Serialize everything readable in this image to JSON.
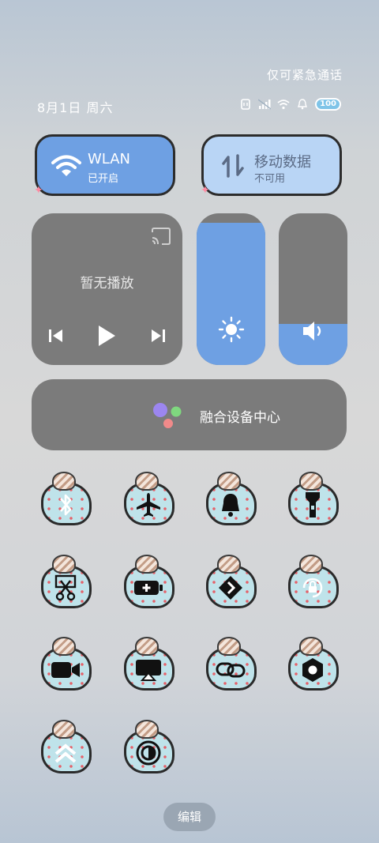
{
  "status_bar": {
    "emergency_text": "仅可紧急通话",
    "date": "8月1日 周六",
    "battery": "100"
  },
  "tiles": {
    "wlan": {
      "title": "WLAN",
      "subtitle": "已开启",
      "icon": "wifi-icon",
      "active": true
    },
    "mobile": {
      "title": "移动数据",
      "subtitle": "不可用",
      "icon": "mobile-data-icon",
      "active": false
    }
  },
  "media": {
    "no_play_text": "暂无播放"
  },
  "sliders": {
    "brightness": {
      "level": 0.94,
      "icon": "sun-icon"
    },
    "volume": {
      "level": 0.27,
      "icon": "speaker-icon"
    }
  },
  "fusion": {
    "label": "融合设备中心"
  },
  "quick_toggles": [
    {
      "name": "bluetooth",
      "icon": "bluetooth-icon",
      "active": false
    },
    {
      "name": "airplane-mode",
      "icon": "airplane-icon",
      "active": false
    },
    {
      "name": "sound",
      "icon": "bell-icon",
      "active": false
    },
    {
      "name": "flashlight",
      "icon": "flashlight-icon",
      "active": false
    },
    {
      "name": "screenshot",
      "icon": "scissors-icon",
      "active": false
    },
    {
      "name": "battery-saver",
      "icon": "battery-plus-icon",
      "active": false
    },
    {
      "name": "share",
      "icon": "share-arrow-icon",
      "active": false
    },
    {
      "name": "auto-rotate",
      "icon": "rotate-lock-icon",
      "active": false
    },
    {
      "name": "screen-record",
      "icon": "video-camera-icon",
      "active": false
    },
    {
      "name": "screen-cast",
      "icon": "cast-screen-icon",
      "active": false
    },
    {
      "name": "link",
      "icon": "link-icon",
      "active": false
    },
    {
      "name": "settings",
      "icon": "hexagon-settings-icon",
      "active": false
    },
    {
      "name": "scroll-screenshot",
      "icon": "double-chevron-up-icon",
      "active": true
    },
    {
      "name": "dark-mode",
      "icon": "contrast-icon",
      "active": false
    }
  ],
  "edit_button": {
    "label": "编辑"
  }
}
